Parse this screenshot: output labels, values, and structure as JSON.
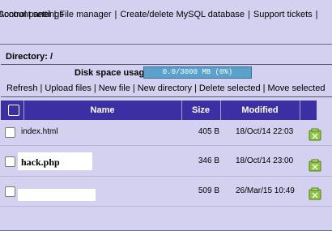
{
  "nav": {
    "row1": [
      "Control panel",
      "File manager",
      "Create/delete MySQL database",
      "Support tickets"
    ],
    "row1_trailing_sep": "|",
    "row2": [
      "Account settings"
    ]
  },
  "directory": {
    "label": "Directory: /"
  },
  "disk": {
    "label": "Disk space usage:",
    "text": "0.0/3000 MB (0%)",
    "percent": 0
  },
  "actions": [
    "Refresh",
    "Upload files",
    "New file",
    "New directory",
    "Delete selected",
    "Move selected"
  ],
  "table": {
    "headers": {
      "name": "Name",
      "size": "Size",
      "modified": "Modified"
    },
    "rows": [
      {
        "name": "index.html",
        "size": "405 B",
        "modified": "18/Oct/14 22:03",
        "name_style": "normal"
      },
      {
        "name": "hack.php",
        "size": "346 B",
        "modified": "18/Oct/14 23:00",
        "name_style": "bold"
      },
      {
        "name": "",
        "size": "509 B",
        "modified": "26/Mar/15 10:49",
        "name_style": "redacted"
      }
    ]
  },
  "icon_color": "#8dc63f",
  "header_color": "#3c2fa4"
}
